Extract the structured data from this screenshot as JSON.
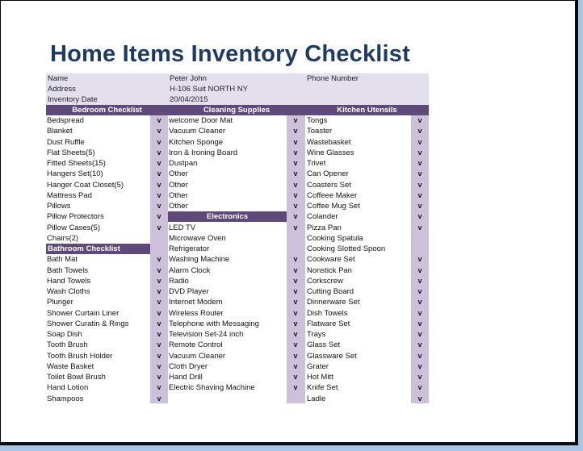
{
  "title": "Home Items Inventory Checklist",
  "info": {
    "name_label": "Name",
    "name_value": "Peter John",
    "address_label": "Address",
    "address_value": "H-106 Suit NORTH NY",
    "date_label": "Inventory Date",
    "date_value": "20/04/2015",
    "phone_label": "Phone Number",
    "phone_value": ""
  },
  "check_glyph": "v",
  "colors": {
    "header": "#5f497a",
    "info_bg": "#e4dfec",
    "check_col": "#ccc0da",
    "title": "#1f3b63"
  },
  "columns": [
    {
      "sections": [
        {
          "title": "Bedroom Checklist",
          "items": [
            {
              "label": "Bedspread",
              "checked": true
            },
            {
              "label": "Blanket",
              "checked": true
            },
            {
              "label": "Dust Ruffle",
              "checked": true
            },
            {
              "label": "Flat Sheets(5)",
              "checked": true
            },
            {
              "label": "Fitted Sheets(15)",
              "checked": true
            },
            {
              "label": "Hangers Set(10)",
              "checked": true
            },
            {
              "label": "Hanger Coat Closet(5)",
              "checked": true
            },
            {
              "label": "Mattress Pad",
              "checked": true
            },
            {
              "label": "Pillows",
              "checked": true
            },
            {
              "label": "Pillow Protectors",
              "checked": true
            },
            {
              "label": "Pillow Cases(5)",
              "checked": true
            },
            {
              "label": "Chairs(2)",
              "checked": false
            }
          ]
        },
        {
          "title": "Bathroom Checklist",
          "items": [
            {
              "label": "Bath Mat",
              "checked": true
            },
            {
              "label": "Bath Towels",
              "checked": true
            },
            {
              "label": "Hand Towels",
              "checked": true
            },
            {
              "label": "Wash Cloths",
              "checked": true
            },
            {
              "label": "Plunger",
              "checked": true
            },
            {
              "label": "Shower Curtain Liner",
              "checked": true
            },
            {
              "label": "Shower Curatin & Rings",
              "checked": true
            },
            {
              "label": "Soap Dish",
              "checked": true
            },
            {
              "label": "Tooth Brush",
              "checked": true
            },
            {
              "label": "Tooth Brush Holder",
              "checked": true
            },
            {
              "label": "Waste Basket",
              "checked": true
            },
            {
              "label": "Toilet Bowl Brush",
              "checked": true
            },
            {
              "label": "Hand Lotion",
              "checked": true
            },
            {
              "label": "Shampoos",
              "checked": true
            }
          ]
        }
      ]
    },
    {
      "sections": [
        {
          "title": "Cleaning Supplies",
          "items": [
            {
              "label": "welcome Door Mat",
              "checked": true
            },
            {
              "label": "Vacuum Cleaner",
              "checked": true
            },
            {
              "label": "Kitchen Sponge",
              "checked": true
            },
            {
              "label": "Iron & Ironing Board",
              "checked": true
            },
            {
              "label": "Dustpan",
              "checked": true
            },
            {
              "label": "Other",
              "checked": true
            },
            {
              "label": "Other",
              "checked": true
            },
            {
              "label": "Other",
              "checked": true
            },
            {
              "label": "Other",
              "checked": true
            }
          ]
        },
        {
          "title": "Electronics",
          "title_checked": true,
          "items": [
            {
              "label": "LED TV",
              "checked": true
            },
            {
              "label": "Microwave Oven",
              "checked": false
            },
            {
              "label": "Refrigerator",
              "checked": false
            },
            {
              "label": "Washing Machine",
              "checked": true
            },
            {
              "label": "Alarm Clock",
              "checked": true
            },
            {
              "label": "Radio",
              "checked": true
            },
            {
              "label": "DVD Player",
              "checked": true
            },
            {
              "label": "Internet Modem",
              "checked": true
            },
            {
              "label": "Wireless Router",
              "checked": true
            },
            {
              "label": "Telephone with Messaging",
              "checked": true
            },
            {
              "label": "Television Set-24 inch",
              "checked": true
            },
            {
              "label": "Remote Control",
              "checked": true
            },
            {
              "label": "Vacuum Cleaner",
              "checked": true
            },
            {
              "label": "Cloth Dryer",
              "checked": true
            },
            {
              "label": "Hand Drill",
              "checked": true
            },
            {
              "label": "Electric Shaving Machine",
              "checked": true
            }
          ]
        }
      ]
    },
    {
      "sections": [
        {
          "title": "Kitchen Utensils",
          "items": [
            {
              "label": "Tongs",
              "checked": true
            },
            {
              "label": "Toaster",
              "checked": true
            },
            {
              "label": "Wastebasket",
              "checked": true
            },
            {
              "label": "Wine Glasses",
              "checked": true
            },
            {
              "label": "Trivet",
              "checked": true
            },
            {
              "label": "Can Opener",
              "checked": true
            },
            {
              "label": "Coasters Set",
              "checked": true
            },
            {
              "label": "Coffeee Maker",
              "checked": true
            },
            {
              "label": "Coffee Mug Set",
              "checked": true
            },
            {
              "label": "Colander",
              "checked": true
            },
            {
              "label": "Pizza Pan",
              "checked": true
            },
            {
              "label": "Cooking Spatula",
              "checked": false
            },
            {
              "label": "Cooking Slotted Spoon",
              "checked": false
            },
            {
              "label": "Cookware Set",
              "checked": true
            },
            {
              "label": "Nonstick Pan",
              "checked": true
            },
            {
              "label": "Corkscrew",
              "checked": true
            },
            {
              "label": "Cutting Board",
              "checked": true
            },
            {
              "label": "Dinnerware Set",
              "checked": true
            },
            {
              "label": "Dish Towels",
              "checked": true
            },
            {
              "label": "Flatware Set",
              "checked": true
            },
            {
              "label": "Trays",
              "checked": true
            },
            {
              "label": "Glass Set",
              "checked": true
            },
            {
              "label": "Glassware Set",
              "checked": true
            },
            {
              "label": "Grater",
              "checked": true
            },
            {
              "label": "Hot Mitt",
              "checked": true
            },
            {
              "label": "Knife Set",
              "checked": true
            },
            {
              "label": "Ladle",
              "checked": true
            }
          ]
        }
      ]
    }
  ]
}
